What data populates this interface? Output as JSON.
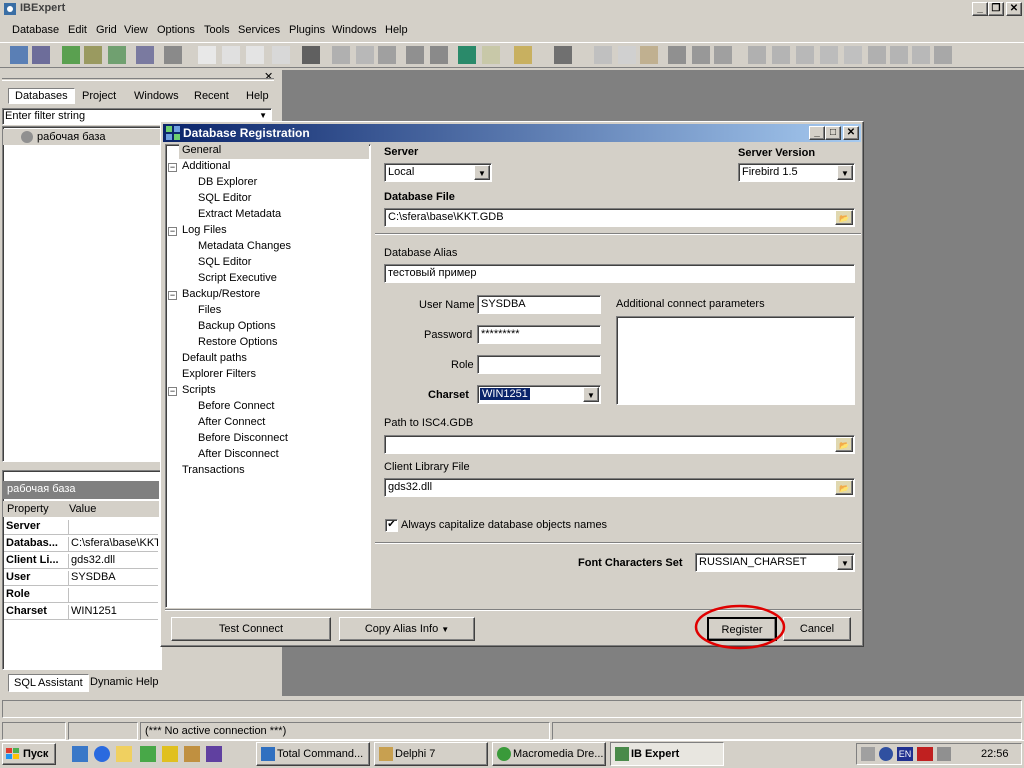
{
  "app": {
    "title": "IBExpert"
  },
  "menu": [
    "Database",
    "Edit",
    "Grid",
    "View",
    "Options",
    "Tools",
    "Services",
    "Plugins",
    "Windows",
    "Help"
  ],
  "db_panel": {
    "tabs": [
      "Databases",
      "Project",
      "Windows",
      "Recent",
      "Help"
    ],
    "filter_value": "Enter filter string",
    "tree_item": "рабочая база"
  },
  "props_panel": {
    "title": "рабочая база",
    "header": [
      "Property",
      "Value"
    ],
    "rows": [
      {
        "k": "Server",
        "v": ""
      },
      {
        "k": "Databas...",
        "v": "C:\\sfera\\base\\KKT"
      },
      {
        "k": "Client Li...",
        "v": "gds32.dll"
      },
      {
        "k": "User",
        "v": "SYSDBA"
      },
      {
        "k": "Role",
        "v": ""
      },
      {
        "k": "Charset",
        "v": "WIN1251"
      }
    ],
    "bottom_tabs": [
      "SQL Assistant",
      "Dynamic Help"
    ]
  },
  "dialog": {
    "title": "Database Registration",
    "tree": [
      {
        "label": "General",
        "level": 0
      },
      {
        "label": "Additional",
        "level": 0
      },
      {
        "label": "DB Explorer",
        "level": 1
      },
      {
        "label": "SQL Editor",
        "level": 1
      },
      {
        "label": "Extract Metadata",
        "level": 1
      },
      {
        "label": "Log Files",
        "level": 0
      },
      {
        "label": "Metadata Changes",
        "level": 1
      },
      {
        "label": "SQL Editor",
        "level": 1
      },
      {
        "label": "Script Executive",
        "level": 1
      },
      {
        "label": "Backup/Restore",
        "level": 0
      },
      {
        "label": "Files",
        "level": 1
      },
      {
        "label": "Backup Options",
        "level": 1
      },
      {
        "label": "Restore Options",
        "level": 1
      },
      {
        "label": "Default paths",
        "level": 0
      },
      {
        "label": "Explorer Filters",
        "level": 0
      },
      {
        "label": "Scripts",
        "level": 0
      },
      {
        "label": "Before Connect",
        "level": 1
      },
      {
        "label": "After Connect",
        "level": 1
      },
      {
        "label": "Before Disconnect",
        "level": 1
      },
      {
        "label": "After Disconnect",
        "level": 1
      },
      {
        "label": "Transactions",
        "level": 0
      }
    ],
    "server_label": "Server",
    "server_value": "Local",
    "server_version_label": "Server Version",
    "server_version_value": "Firebird 1.5",
    "db_file_label": "Database File",
    "db_file_value": "C:\\sfera\\base\\KKT.GDB",
    "alias_label": "Database Alias",
    "alias_value": "тестовый пример",
    "user_label": "User Name",
    "user_value": "SYSDBA",
    "password_label": "Password",
    "password_value": "*********",
    "role_label": "Role",
    "role_value": "",
    "charset_label": "Charset",
    "charset_value": "WIN1251",
    "additional_label": "Additional connect parameters",
    "isc4_label": "Path to ISC4.GDB",
    "isc4_value": "",
    "client_lib_label": "Client Library File",
    "client_lib_value": "gds32.dll",
    "capitalize_label": "Always capitalize database objects names",
    "font_charset_label": "Font Characters Set",
    "font_charset_value": "RUSSIAN_CHARSET",
    "buttons": {
      "test_connect": "Test Connect",
      "copy_alias": "Copy Alias Info",
      "register": "Register",
      "cancel": "Cancel"
    }
  },
  "status": {
    "connection": "(*** No active connection ***)"
  },
  "taskbar": {
    "start": "Пуск",
    "tasks": [
      "Total Command...",
      "Delphi 7",
      "Macromedia Dre...",
      "IB Expert"
    ],
    "tray_lang": "EN",
    "clock": "22:56"
  },
  "colors": {
    "titlebar": "#0a246a",
    "titlebar_end": "#a6caf0",
    "desktop_mdi": "#808080",
    "highlight": "#0a246a",
    "annotation": "#e00000"
  }
}
